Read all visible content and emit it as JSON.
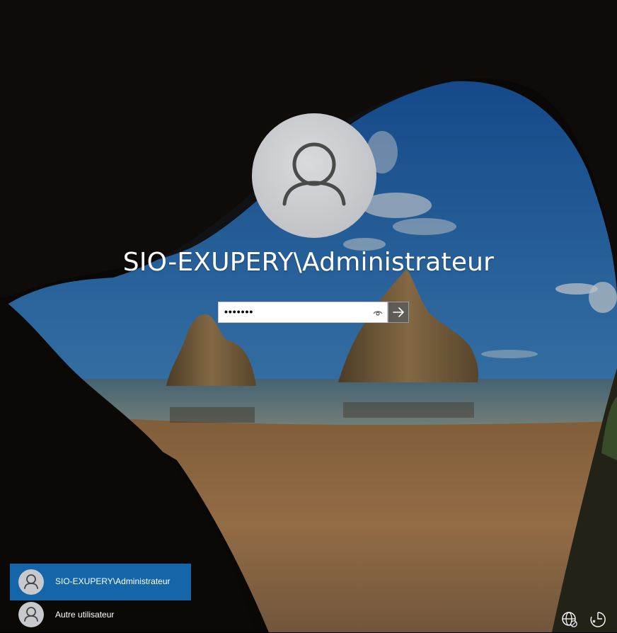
{
  "login": {
    "username": "SIO-EXUPERY\\Administrateur",
    "password_mask": "•••••••"
  },
  "user_list": [
    {
      "label": "SIO-EXUPERY\\Administrateur",
      "selected": true
    },
    {
      "label": "Autre utilisateur",
      "selected": false
    }
  ],
  "icons": {
    "avatar": "user-icon",
    "reveal": "eye-icon",
    "submit": "arrow-right-icon",
    "network": "network-icon",
    "ease_of_access": "ease-of-access-icon"
  }
}
